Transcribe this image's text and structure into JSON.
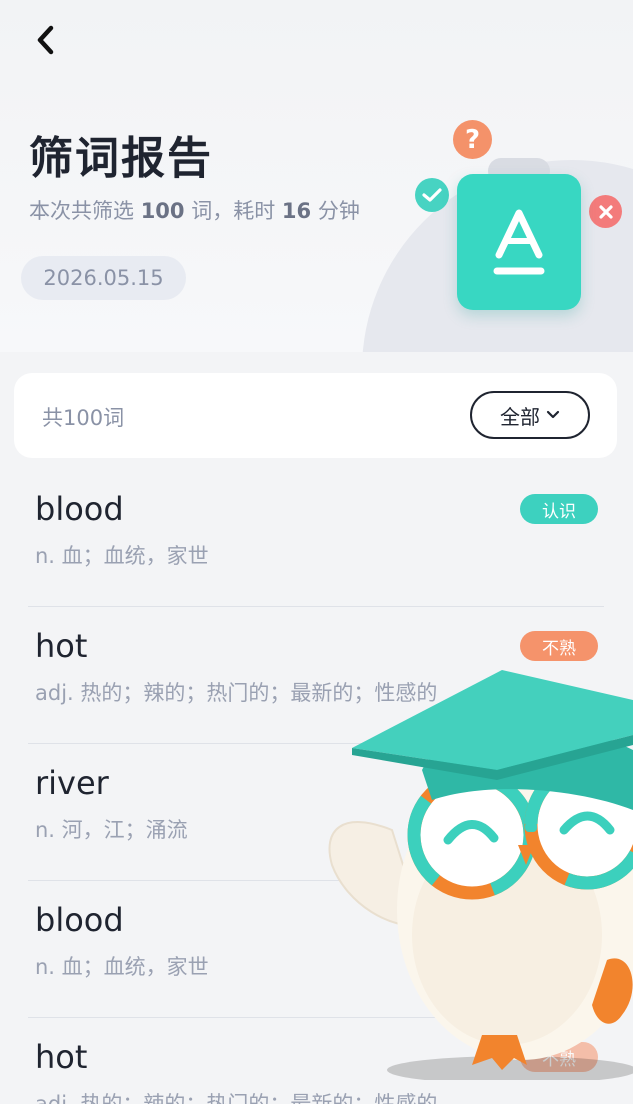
{
  "header": {
    "title": "筛词报告",
    "subtitle_prefix": "本次共筛选",
    "word_count": "100",
    "subtitle_mid": "词，耗时",
    "minutes": "16",
    "subtitle_suffix": "分钟",
    "date": "2026.05.15",
    "back_icon": "chevron-left-icon"
  },
  "summary": {
    "count_label": "共100词",
    "filter_label": "全部"
  },
  "words": [
    {
      "word": "blood",
      "meaning": "n. 血；血统，家世",
      "tag": "认识",
      "status": "known"
    },
    {
      "word": "hot",
      "meaning": "adj. 热的；辣的；热门的；最新的；性感的",
      "tag": "不熟",
      "status": "unfamiliar"
    },
    {
      "word": "river",
      "meaning": "n. 河，江；涌流",
      "tag": "",
      "status": "none"
    },
    {
      "word": "blood",
      "meaning": "n. 血；血统，家世",
      "tag": "",
      "status": "none"
    },
    {
      "word": "hot",
      "meaning": "adj. 热的；辣的；热门的；最新的；性感的",
      "tag": "不熟",
      "status": "unfamiliar"
    }
  ],
  "colors": {
    "accent_teal": "#38d7c2",
    "known_tag": "#3dd1bf",
    "unfamiliar_tag": "#f5936b",
    "error_red": "#f37b7b",
    "question_orange": "#f4926a"
  }
}
